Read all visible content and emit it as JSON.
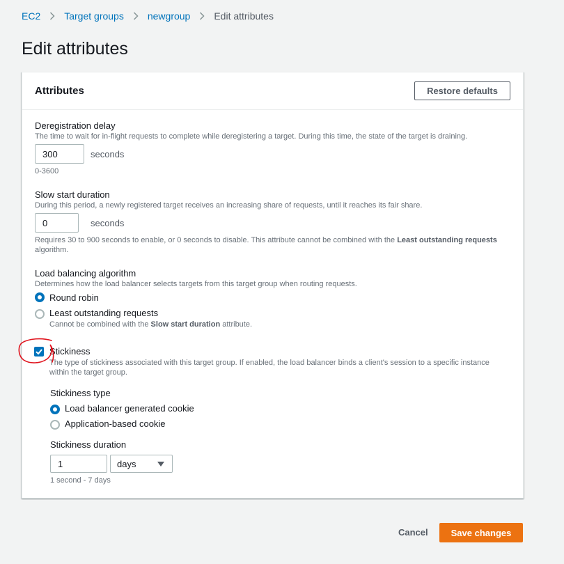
{
  "breadcrumb": {
    "items": [
      "EC2",
      "Target groups",
      "newgroup"
    ],
    "current": "Edit attributes"
  },
  "page_title": "Edit attributes",
  "panel": {
    "title": "Attributes",
    "restore_label": "Restore defaults"
  },
  "deregistration": {
    "label": "Deregistration delay",
    "description": "The time to wait for in-flight requests to complete while deregistering a target. During this time, the state of the target is draining.",
    "value": "300",
    "unit": "seconds",
    "hint": "0-3600"
  },
  "slow_start": {
    "label": "Slow start duration",
    "description": "During this period, a newly registered target receives an increasing share of requests, until it reaches its fair share.",
    "value": "0",
    "unit": "seconds",
    "hint_part1": "Requires 30 to 900 seconds to enable, or 0 seconds to disable. This attribute cannot be combined with the ",
    "hint_bold": "Least outstanding requests",
    "hint_part2": "algorithm."
  },
  "algorithm": {
    "label": "Load balancing algorithm",
    "description": "Determines how the load balancer selects targets from this target group when routing requests.",
    "options": [
      {
        "label": "Round robin",
        "selected": true
      },
      {
        "label": "Least outstanding requests",
        "selected": false
      }
    ],
    "lor_note_part1": "Cannot be combined with the ",
    "lor_note_bold": "Slow start duration",
    "lor_note_part2": " attribute."
  },
  "stickiness": {
    "label": "Stickiness",
    "checked": true,
    "description_line1": "The type of stickiness associated with this target group. If enabled, the load balancer binds a client's session to a specific instance",
    "description_line2": "within the target group.",
    "type_label": "Stickiness type",
    "type_options": [
      {
        "label": "Load balancer generated cookie",
        "selected": true
      },
      {
        "label": "Application-based cookie",
        "selected": false
      }
    ],
    "duration_label": "Stickiness duration",
    "duration_value": "1",
    "duration_unit": "days",
    "duration_hint": "1 second - 7 days"
  },
  "footer": {
    "cancel_label": "Cancel",
    "save_label": "Save changes"
  },
  "colors": {
    "accent": "#0073bb",
    "primary_button": "#ec7211",
    "annotation": "#e0141e"
  }
}
